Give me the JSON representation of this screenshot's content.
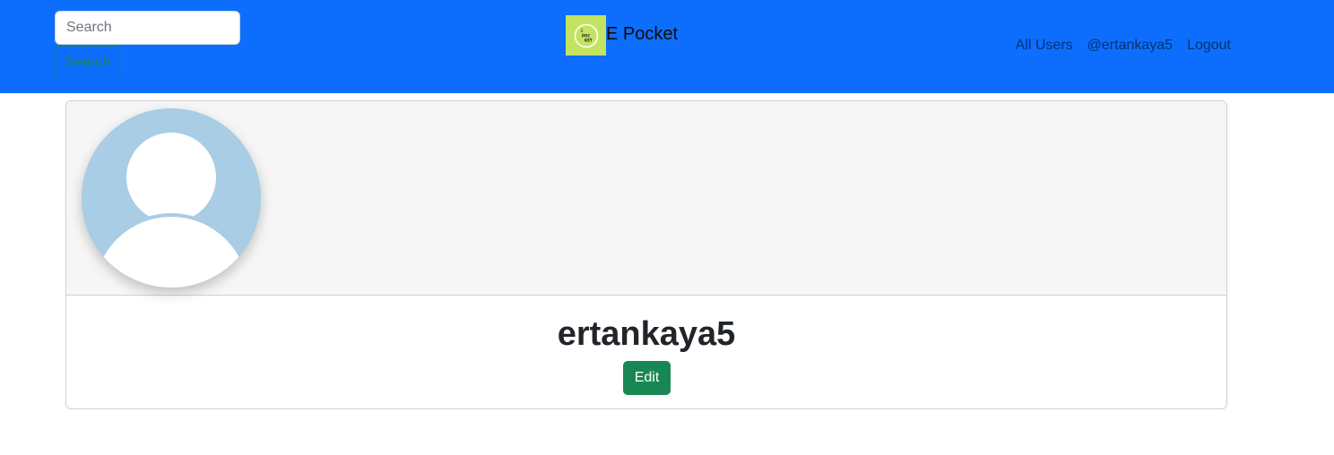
{
  "navbar": {
    "background": "#0d6efd",
    "search": {
      "placeholder": "Search",
      "value": "",
      "button_label": "Search"
    },
    "brand": {
      "logo_text": "E POCKET",
      "name": "E Pocket"
    },
    "links": [
      {
        "label": "All Users"
      },
      {
        "label": "@ertankaya5"
      },
      {
        "label": "Logout"
      }
    ]
  },
  "profile": {
    "username": "ertankaya5",
    "edit_label": "Edit",
    "avatar_icon": "default-user-icon",
    "accent": "#198754"
  }
}
